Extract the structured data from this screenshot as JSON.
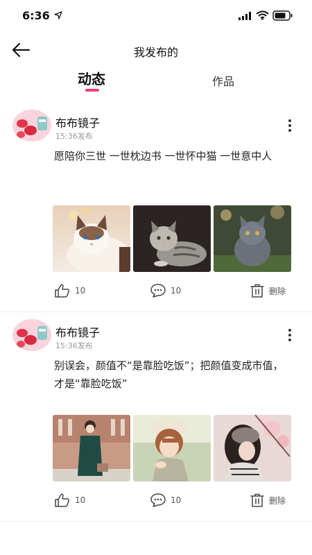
{
  "status_bar": {
    "time": "6:36"
  },
  "nav": {
    "title": "我发布的"
  },
  "tabs": [
    {
      "label": "动态",
      "active": true
    },
    {
      "label": "作品",
      "active": false
    }
  ],
  "posts": [
    {
      "username": "布布镜子",
      "time": "15:36发布",
      "content": "愿陪你三世 一世枕边书 一世怀中猫 一世意中人",
      "images": [
        "ragdoll-cat-photo",
        "tabby-cat-photo",
        "grey-cat-photo"
      ],
      "likes": "10",
      "comments": "10",
      "delete_label": "删除"
    },
    {
      "username": "布布镜子",
      "time": "15:36发布",
      "content": "别误会，颜值不“是靠脸吃饭”；把颜值变成市值，才是“靠脸吃饭”",
      "images": [
        "girl-green-dress-photo",
        "girl-beret-photo",
        "girl-blossom-photo"
      ],
      "likes": "10",
      "comments": "10",
      "delete_label": "删除"
    }
  ],
  "colors": {
    "accent": "#ee3d7b",
    "text": "#222222",
    "muted": "#999999"
  }
}
